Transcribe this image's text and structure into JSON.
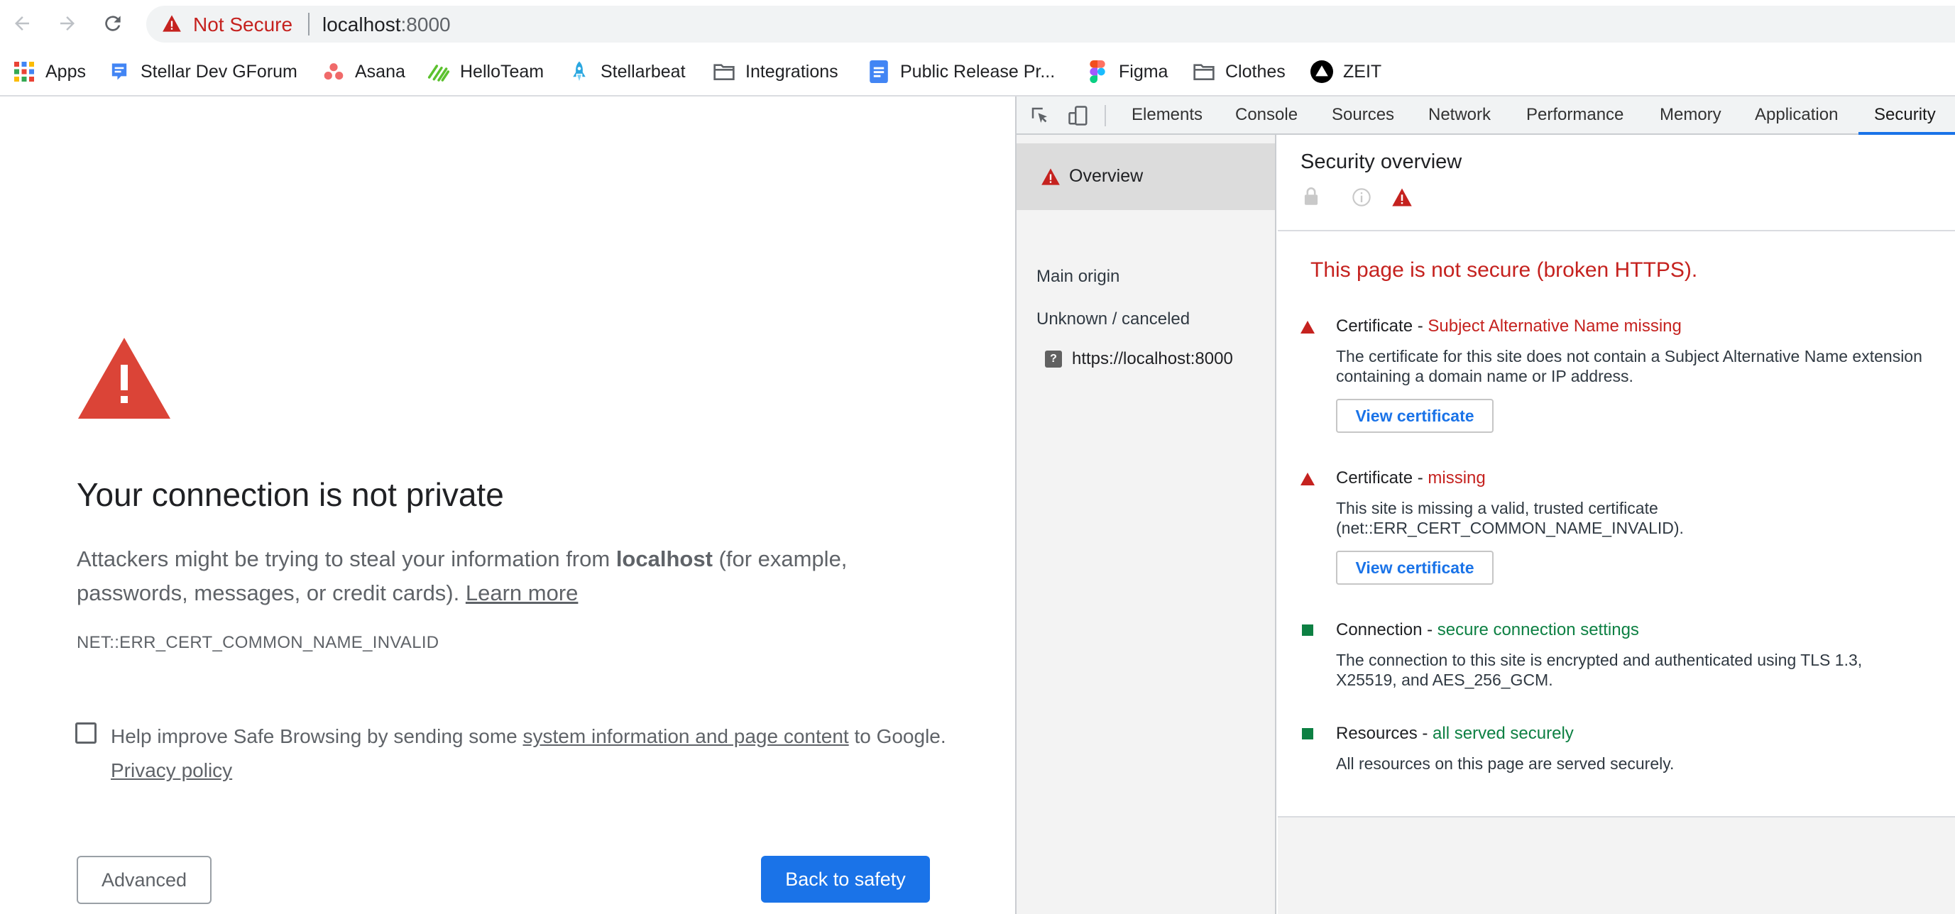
{
  "browser": {
    "omnibox": {
      "security_status": "Not Secure",
      "host": "localhost",
      "port": ":8000"
    },
    "bookmarks": [
      {
        "label": "Apps",
        "icon": "apps-grid-icon"
      },
      {
        "label": "Stellar Dev GForum",
        "icon": "forum-icon"
      },
      {
        "label": "Asana",
        "icon": "asana-icon"
      },
      {
        "label": "HelloTeam",
        "icon": "helloteam-icon"
      },
      {
        "label": "Stellarbeat",
        "icon": "rocket-icon"
      },
      {
        "label": "Integrations",
        "icon": "folder-icon"
      },
      {
        "label": "Public Release Pr...",
        "icon": "docs-icon"
      },
      {
        "label": "Figma",
        "icon": "figma-icon"
      },
      {
        "label": "Clothes",
        "icon": "folder-icon"
      },
      {
        "label": "ZEIT",
        "icon": "zeit-icon"
      }
    ]
  },
  "interstitial": {
    "heading": "Your connection is not private",
    "explanation_prefix": "Attackers might be trying to steal your information from ",
    "explanation_host": "localhost",
    "explanation_suffix": " (for example, passwords, messages, or credit cards). ",
    "learn_more": "Learn more",
    "error_code": "NET::ERR_CERT_COMMON_NAME_INVALID",
    "safe_browsing_prefix": "Help improve Safe Browsing by sending some ",
    "safe_browsing_link": "system information and page content",
    "safe_browsing_suffix": " to Google. ",
    "privacy_policy": "Privacy policy",
    "advanced_button": "Advanced",
    "back_button": "Back to safety"
  },
  "devtools": {
    "tabs": [
      "Elements",
      "Console",
      "Sources",
      "Network",
      "Performance",
      "Memory",
      "Application",
      "Security"
    ],
    "active_tab": "Security",
    "sidebar": {
      "overview": "Overview",
      "main_origin": "Main origin",
      "unknown_canceled": "Unknown / canceled",
      "origin_url": "https://localhost:8000"
    },
    "overview": {
      "title": "Security overview",
      "summary": "This page is not secure (broken HTTPS).",
      "explanations": [
        {
          "severity": "insecure",
          "title": "Certificate",
          "separator": " - ",
          "summary": "Subject Alternative Name missing",
          "description": "The certificate for this site does not contain a Subject Alternative Name extension containing a domain name or IP address.",
          "button": "View certificate"
        },
        {
          "severity": "insecure",
          "title": "Certificate",
          "separator": " - ",
          "summary": "missing",
          "description": "This site is missing a valid, trusted certificate (net::ERR_CERT_COMMON_NAME_INVALID).",
          "button": "View certificate"
        },
        {
          "severity": "secure",
          "title": "Connection",
          "separator": " - ",
          "summary": "secure connection settings",
          "description": "The connection to this site is encrypted and authenticated using TLS 1.3, X25519, and AES_256_GCM."
        },
        {
          "severity": "secure",
          "title": "Resources",
          "separator": " - ",
          "summary": "all served securely",
          "description": "All resources on this page are served securely."
        }
      ]
    }
  },
  "colors": {
    "insecure_red": "#c5221f",
    "secure_green": "#0d8043",
    "accent_blue": "#1a73e8",
    "interstitial_red": "#db4437"
  }
}
